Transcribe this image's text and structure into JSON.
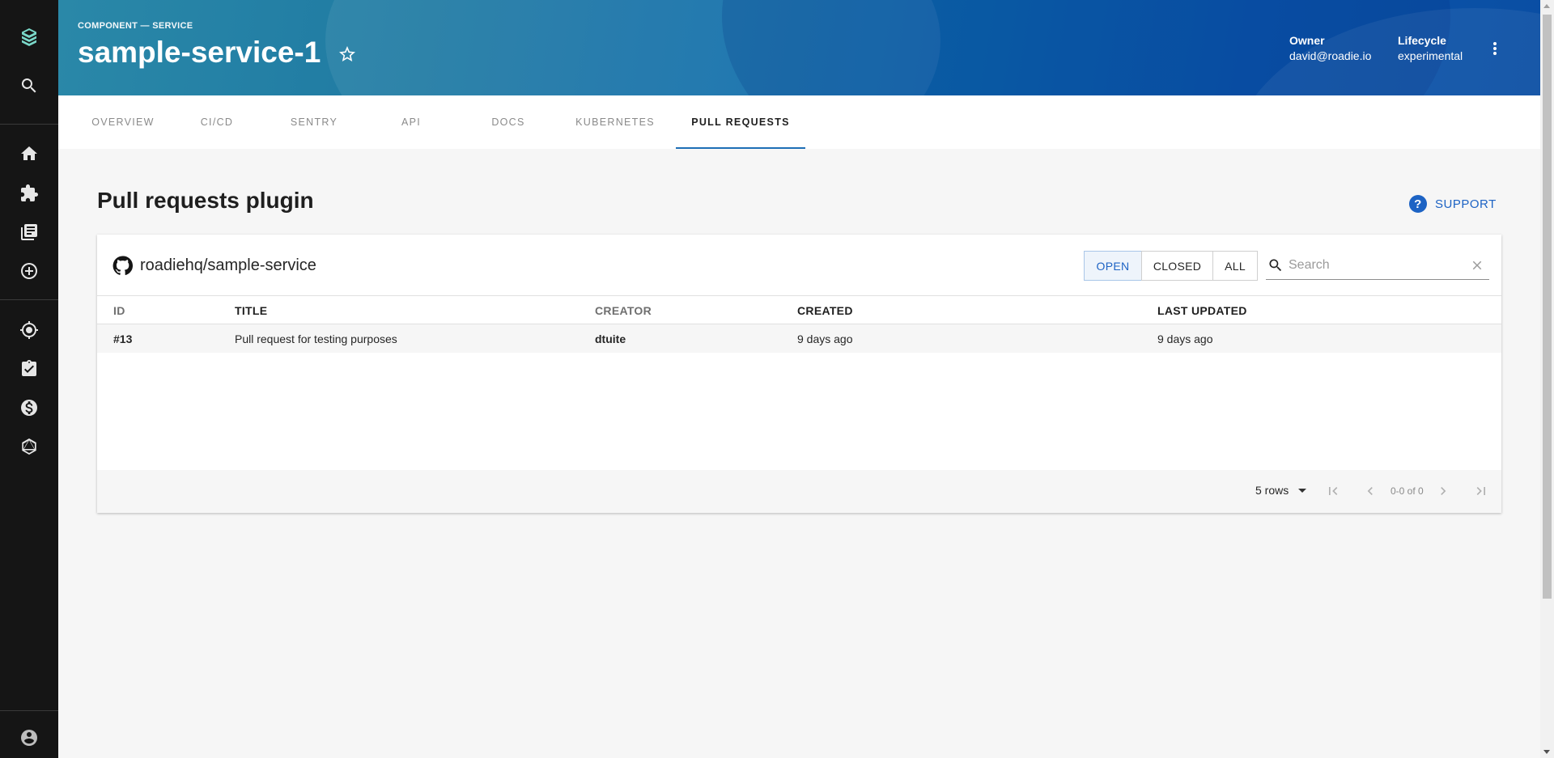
{
  "header": {
    "breadcrumb": "COMPONENT — SERVICE",
    "title": "sample-service-1",
    "owner_label": "Owner",
    "owner_value": "david@roadie.io",
    "lifecycle_label": "Lifecycle",
    "lifecycle_value": "experimental"
  },
  "tabs": [
    "OVERVIEW",
    "CI/CD",
    "SENTRY",
    "API",
    "DOCS",
    "KUBERNETES",
    "PULL REQUESTS"
  ],
  "active_tab": "PULL REQUESTS",
  "page": {
    "heading": "Pull requests plugin",
    "support_label": "SUPPORT"
  },
  "card": {
    "repo": "roadiehq/sample-service",
    "filters": [
      "OPEN",
      "CLOSED",
      "ALL"
    ],
    "active_filter": "OPEN",
    "search_placeholder": "Search",
    "columns": [
      "ID",
      "TITLE",
      "CREATOR",
      "CREATED",
      "LAST UPDATED"
    ],
    "rows": [
      {
        "id": "#13",
        "title": "Pull request for testing purposes",
        "creator": "dtuite",
        "created": "9 days ago",
        "updated": "9 days ago"
      }
    ],
    "rows_per_page": "5 rows",
    "pagination_text": "0-0 of 0"
  },
  "icons": {
    "sidebar": [
      "logo-icon",
      "search-icon",
      "home-icon",
      "puzzle-icon",
      "library-icon",
      "add-circle-icon",
      "radar-icon",
      "checklist-icon",
      "cost-icon",
      "graphql-icon",
      "account-icon"
    ],
    "accent": "#1d63c4"
  }
}
